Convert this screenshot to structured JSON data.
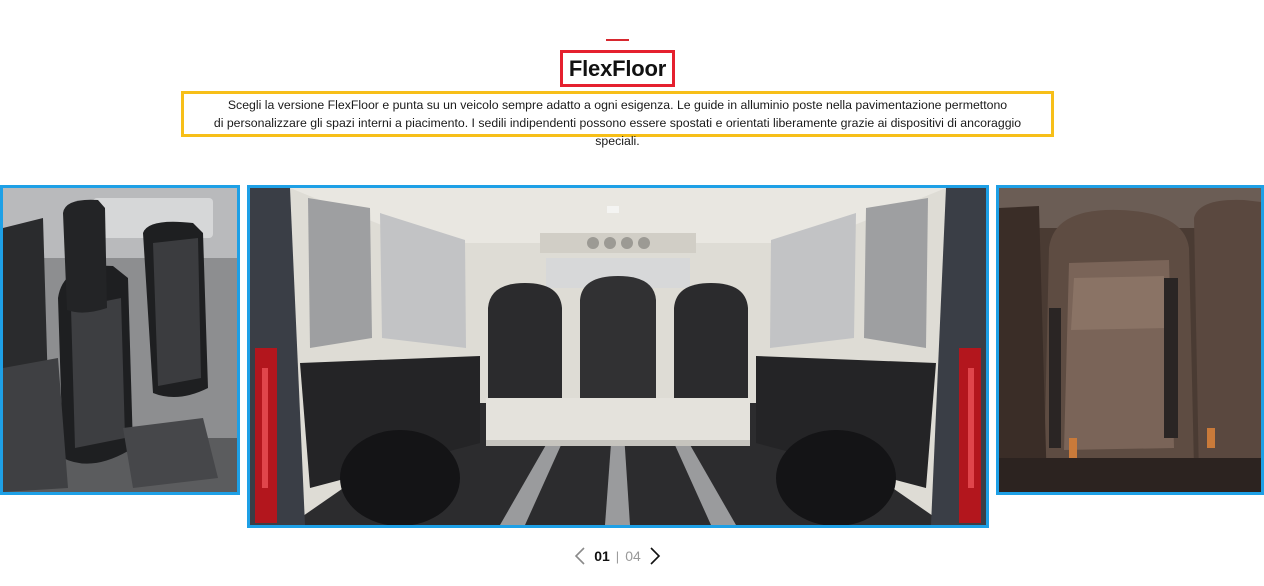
{
  "section": {
    "title": "FlexFloor",
    "description_line1": "Scegli la versione FlexFloor e punta su un veicolo sempre adatto a ogni esigenza. Le guide in alluminio poste nella pavimentazione permettono",
    "description_line2": "di personalizzare gli spazi interni a piacimento. I sedili indipendenti possono essere spostati e orientati liberamente grazie ai dispositivi di ancoraggio speciali."
  },
  "carousel": {
    "current": "01",
    "separator": "|",
    "total": "04",
    "prev_icon": "chevron-left-icon",
    "next_icon": "chevron-right-icon"
  },
  "colors": {
    "accent_red": "#e5202e",
    "highlight_yellow": "#f7bf18",
    "highlight_blue": "#1ea0e6"
  }
}
